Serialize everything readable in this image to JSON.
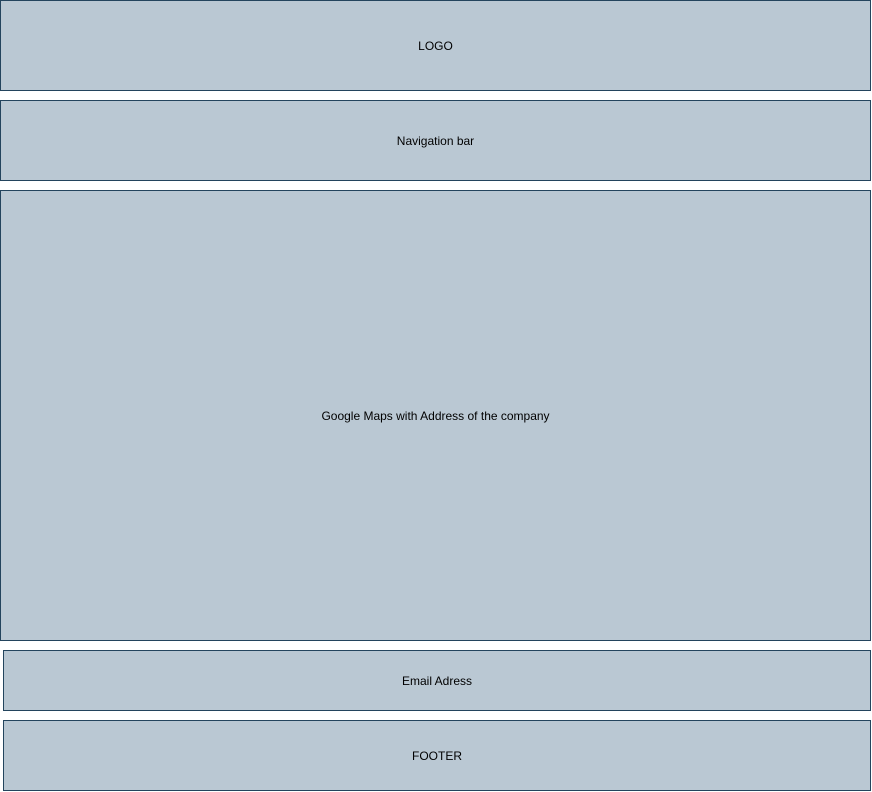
{
  "logo": {
    "label": "LOGO"
  },
  "navigation": {
    "label": "Navigation bar"
  },
  "map": {
    "label": "Google Maps with Address of the company"
  },
  "email": {
    "label": "Email Adress"
  },
  "footer": {
    "label": "FOOTER"
  },
  "colors": {
    "fill": "#bac8d3",
    "stroke": "#23445d"
  }
}
